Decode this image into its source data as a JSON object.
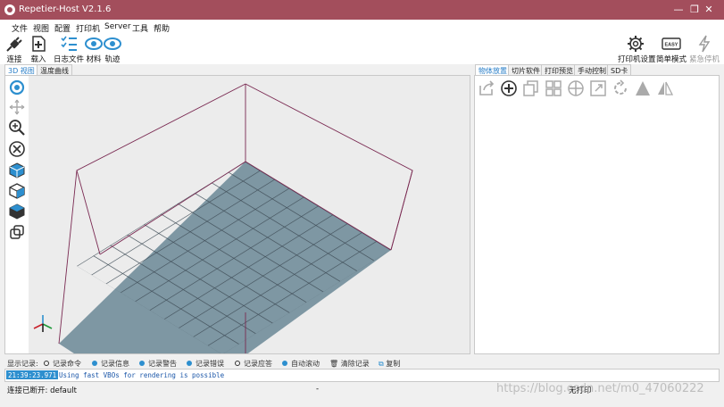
{
  "window": {
    "title": "Repetier-Host V2.1.6",
    "controls": [
      "minimize-icon",
      "restore-icon",
      "close-icon"
    ]
  },
  "menu": [
    "文件",
    "视图",
    "配置",
    "打印机",
    "Server",
    "工具",
    "帮助"
  ],
  "toolbar": {
    "connect": "连接",
    "load": "载入",
    "log": "日志文件",
    "material": "材料",
    "path": "轨迹",
    "printer_settings": "打印机设置",
    "easy_mode": "简单模式",
    "easy_badge": "EASY",
    "emergency_stop": "紧急停机"
  },
  "view_tabs": [
    "3D 视图",
    "温度曲线"
  ],
  "right_tabs": [
    "物体放置",
    "切片软件",
    "打印预览",
    "手动控制",
    "SD卡"
  ],
  "log_options": {
    "label": "显示记录:",
    "items": [
      {
        "label": "记录命令",
        "checked": false
      },
      {
        "label": "记录信息",
        "checked": true
      },
      {
        "label": "记录警告",
        "checked": true
      },
      {
        "label": "记录错误",
        "checked": true
      },
      {
        "label": "记录应答",
        "checked": false
      },
      {
        "label": "自动滚动",
        "checked": true
      }
    ],
    "clear": "清除记录",
    "copy": "复制"
  },
  "log_entries": [
    {
      "time": "21:39:23.971",
      "message": "Using fast VBOs for rendering is possible"
    }
  ],
  "status": {
    "connection": "连接已断开: default",
    "middle": "-",
    "print_status": "无打印"
  },
  "watermark": "https://blog.csdn.net/m0_47060222",
  "colors": {
    "titlebar": "#a34e5c",
    "accent": "#2d8fcf",
    "bed": "#7e97a3",
    "grid": "#3f4d57",
    "frame": "#7a2a52"
  }
}
